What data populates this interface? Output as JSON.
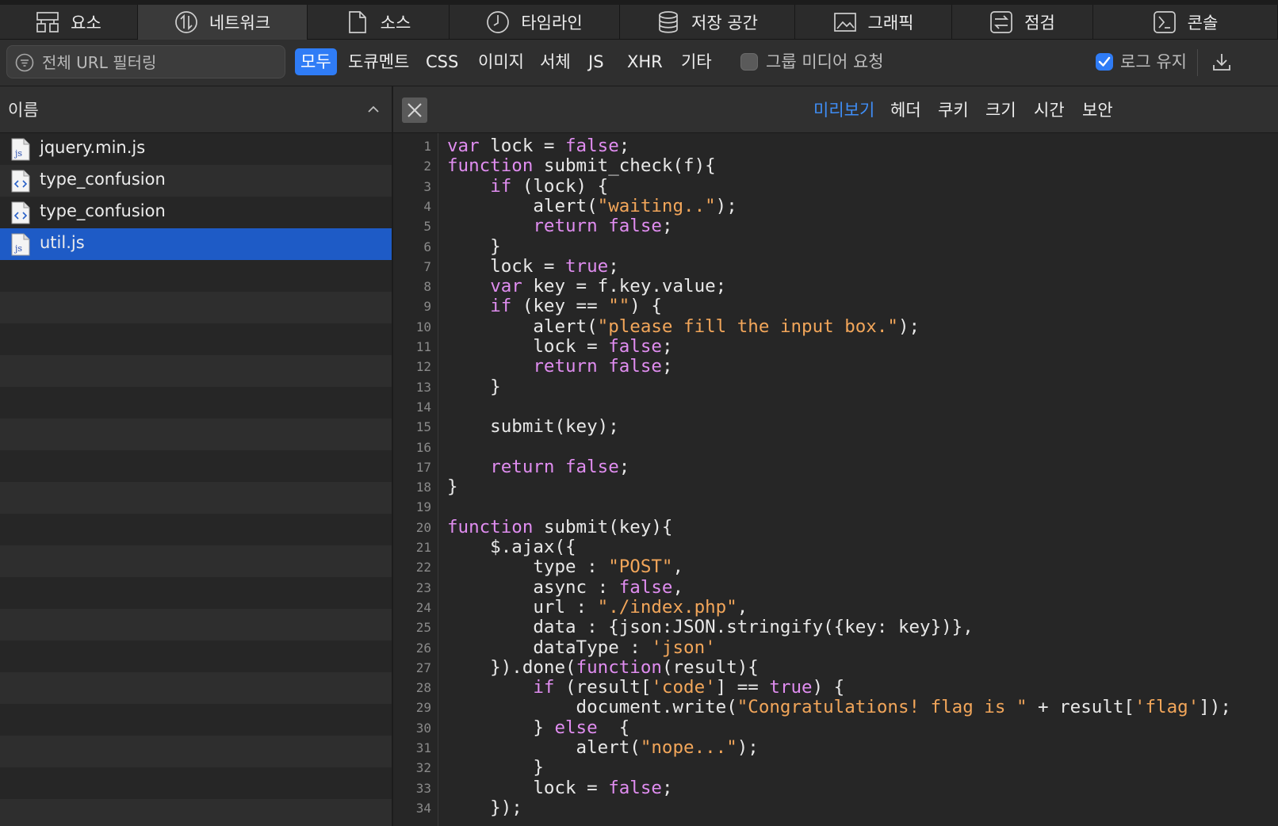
{
  "tabs": [
    {
      "label": "요소",
      "icon": "elements-icon"
    },
    {
      "label": "네트워크",
      "icon": "network-icon",
      "active": true
    },
    {
      "label": "소스",
      "icon": "document-icon"
    },
    {
      "label": "타임라인",
      "icon": "clock-icon"
    },
    {
      "label": "저장 공간",
      "icon": "database-icon"
    },
    {
      "label": "그래픽",
      "icon": "image-icon"
    },
    {
      "label": "점검",
      "icon": "audit-icon"
    },
    {
      "label": "콘솔",
      "icon": "console-icon"
    }
  ],
  "filterbar": {
    "search_placeholder": "전체 URL 필터링",
    "types": [
      "모두",
      "도큐멘트",
      "CSS",
      "이미지",
      "서체",
      "JS",
      "XHR",
      "기타"
    ],
    "active_type": "모두",
    "group_media_label": "그룹 미디어 요청",
    "group_media_checked": false,
    "preserve_log_label": "로그 유지",
    "preserve_log_checked": true
  },
  "file_list": {
    "column_name": "이름",
    "files": [
      {
        "name": "jquery.min.js",
        "icon": "js-file-icon"
      },
      {
        "name": "type_confusion",
        "icon": "html-file-icon"
      },
      {
        "name": "type_confusion",
        "icon": "html-file-icon"
      },
      {
        "name": "util.js",
        "icon": "js-file-icon",
        "selected": true
      }
    ]
  },
  "detail_tabs": [
    "미리보기",
    "헤더",
    "쿠키",
    "크기",
    "시간",
    "보안"
  ],
  "active_detail_tab": "미리보기",
  "code_lines": [
    [
      [
        "k",
        "var"
      ],
      [
        "",
        "lock = "
      ],
      [
        "k",
        "false"
      ],
      [
        "",
        ";"
      ]
    ],
    [
      [
        "k",
        "function"
      ],
      [
        "",
        "submit_check(f){"
      ]
    ],
    [
      [
        "",
        "    "
      ],
      [
        "k",
        "if"
      ],
      [
        "",
        "(lock) {"
      ]
    ],
    [
      [
        "",
        "        alert("
      ],
      [
        "s",
        "\"waiting..\""
      ],
      [
        "",
        ");"
      ]
    ],
    [
      [
        "",
        "        "
      ],
      [
        "k",
        "return false"
      ],
      [
        "",
        ";"
      ]
    ],
    [
      [
        "",
        "    }"
      ]
    ],
    [
      [
        "",
        "    lock = "
      ],
      [
        "k",
        "true"
      ],
      [
        "",
        ";"
      ]
    ],
    [
      [
        "",
        "    "
      ],
      [
        "k",
        "var"
      ],
      [
        "",
        "key = f.key.value;"
      ]
    ],
    [
      [
        "",
        "    "
      ],
      [
        "k",
        "if"
      ],
      [
        "",
        "(key == "
      ],
      [
        "s",
        "\"\""
      ],
      [
        "",
        ") {"
      ]
    ],
    [
      [
        "",
        "        alert("
      ],
      [
        "s",
        "\"please fill the input box.\""
      ],
      [
        "",
        ");"
      ]
    ],
    [
      [
        "",
        "        lock = "
      ],
      [
        "k",
        "false"
      ],
      [
        "",
        ";"
      ]
    ],
    [
      [
        "",
        "        "
      ],
      [
        "k",
        "return false"
      ],
      [
        "",
        ";"
      ]
    ],
    [
      [
        "",
        "    }"
      ]
    ],
    [
      [
        "",
        ""
      ]
    ],
    [
      [
        "",
        "    submit(key);"
      ]
    ],
    [
      [
        "",
        ""
      ]
    ],
    [
      [
        "",
        "    "
      ],
      [
        "k",
        "return false"
      ],
      [
        "",
        ";"
      ]
    ],
    [
      [
        "",
        "}"
      ]
    ],
    [
      [
        "",
        ""
      ]
    ],
    [
      [
        "k",
        "function"
      ],
      [
        "",
        "submit(key){"
      ]
    ],
    [
      [
        "",
        "    $.ajax({"
      ]
    ],
    [
      [
        "",
        "        type : "
      ],
      [
        "s",
        "\"POST\""
      ],
      [
        "",
        ","
      ]
    ],
    [
      [
        "",
        "        async : "
      ],
      [
        "k",
        "false"
      ],
      [
        "",
        ","
      ]
    ],
    [
      [
        "",
        "        url : "
      ],
      [
        "s",
        "\"./index.php\""
      ],
      [
        "",
        ","
      ]
    ],
    [
      [
        "",
        "        data : {json:JSON.stringify({key: key})},"
      ]
    ],
    [
      [
        "",
        "        dataType : "
      ],
      [
        "s",
        "'json'"
      ]
    ],
    [
      [
        "",
        "    }).done("
      ],
      [
        "k",
        "function"
      ],
      [
        "",
        "(result){"
      ]
    ],
    [
      [
        "",
        "        "
      ],
      [
        "k",
        "if"
      ],
      [
        "",
        "(result["
      ],
      [
        "s",
        "'code'"
      ],
      [
        "",
        "] == "
      ],
      [
        "k",
        "true"
      ],
      [
        "",
        ") {"
      ]
    ],
    [
      [
        "",
        "            document.write("
      ],
      [
        "s",
        "\"Congratulations! flag is \""
      ],
      [
        "",
        " + result["
      ],
      [
        "s",
        "'flag'"
      ],
      [
        "",
        "]);"
      ]
    ],
    [
      [
        "",
        "        } "
      ],
      [
        "k",
        "else"
      ],
      [
        "",
        " {"
      ]
    ],
    [
      [
        "",
        "            alert("
      ],
      [
        "s",
        "\"nope...\""
      ],
      [
        "",
        ");"
      ]
    ],
    [
      [
        "",
        "        }"
      ]
    ],
    [
      [
        "",
        "        lock = "
      ],
      [
        "k",
        "false"
      ],
      [
        "",
        ";"
      ]
    ],
    [
      [
        "",
        "    });"
      ]
    ]
  ]
}
